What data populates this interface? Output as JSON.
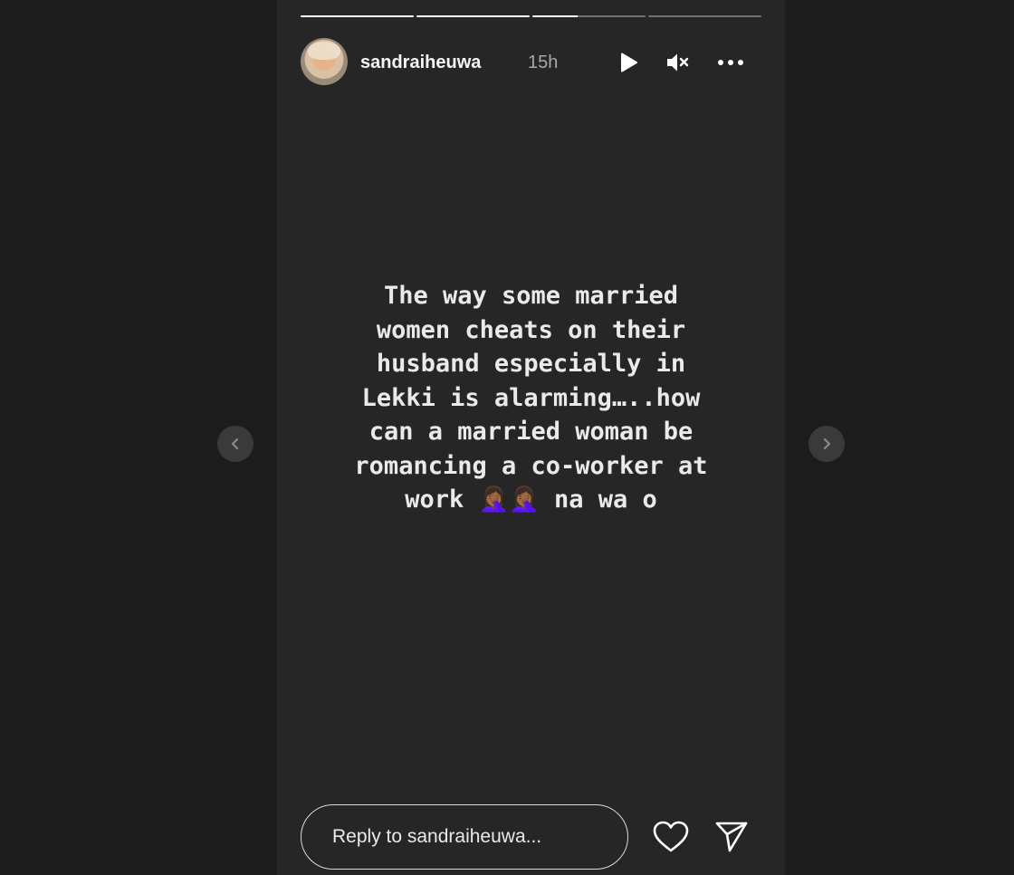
{
  "story": {
    "progress_segments": 4,
    "progress_current": 3,
    "progress_current_fraction": 0.4
  },
  "header": {
    "username": "sandraiheuwa",
    "time_ago": "15h",
    "icons": {
      "play": "play-icon",
      "mute": "speaker-muted-icon",
      "more": "more-options-icon"
    }
  },
  "content": {
    "caption": "The way some married\nwomen cheats on their\nhusband especially in\nLekki is alarming…..how\ncan a married woman be\nromancing a co-worker at\nwork 🤦🏾‍♀️🤦🏾‍♀️ na wa o"
  },
  "navigation": {
    "prev_icon": "chevron-left-icon",
    "next_icon": "chevron-right-icon"
  },
  "footer": {
    "reply_placeholder": "Reply to sandraiheuwa...",
    "like_icon": "heart-icon",
    "share_icon": "send-icon"
  },
  "colors": {
    "page_background": "#1c1c1c",
    "story_background": "#262626",
    "text": "#f5f5f5",
    "muted_text": "#a8a8a8"
  }
}
